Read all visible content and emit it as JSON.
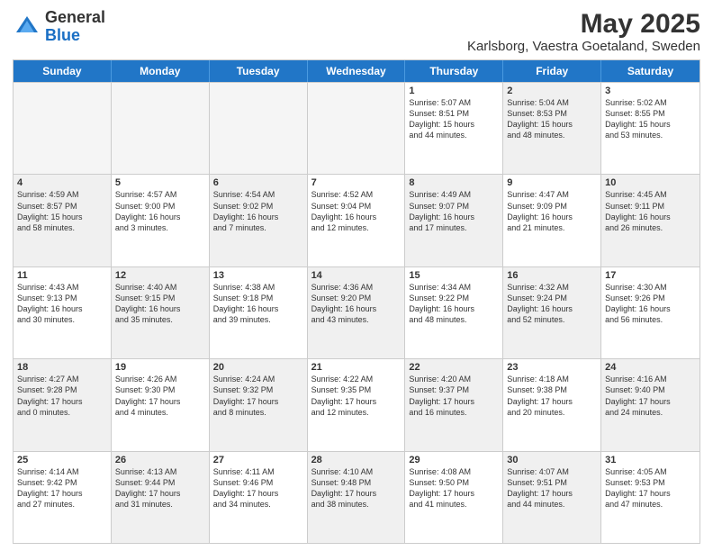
{
  "logo": {
    "general": "General",
    "blue": "Blue"
  },
  "title": "May 2025",
  "subtitle": "Karlsborg, Vaestra Goetaland, Sweden",
  "headers": [
    "Sunday",
    "Monday",
    "Tuesday",
    "Wednesday",
    "Thursday",
    "Friday",
    "Saturday"
  ],
  "rows": [
    [
      {
        "day": "",
        "info": "",
        "empty": true
      },
      {
        "day": "",
        "info": "",
        "empty": true
      },
      {
        "day": "",
        "info": "",
        "empty": true
      },
      {
        "day": "",
        "info": "",
        "empty": true
      },
      {
        "day": "1",
        "info": "Sunrise: 5:07 AM\nSunset: 8:51 PM\nDaylight: 15 hours\nand 44 minutes."
      },
      {
        "day": "2",
        "info": "Sunrise: 5:04 AM\nSunset: 8:53 PM\nDaylight: 15 hours\nand 48 minutes.",
        "shaded": true
      },
      {
        "day": "3",
        "info": "Sunrise: 5:02 AM\nSunset: 8:55 PM\nDaylight: 15 hours\nand 53 minutes."
      }
    ],
    [
      {
        "day": "4",
        "info": "Sunrise: 4:59 AM\nSunset: 8:57 PM\nDaylight: 15 hours\nand 58 minutes.",
        "shaded": true
      },
      {
        "day": "5",
        "info": "Sunrise: 4:57 AM\nSunset: 9:00 PM\nDaylight: 16 hours\nand 3 minutes."
      },
      {
        "day": "6",
        "info": "Sunrise: 4:54 AM\nSunset: 9:02 PM\nDaylight: 16 hours\nand 7 minutes.",
        "shaded": true
      },
      {
        "day": "7",
        "info": "Sunrise: 4:52 AM\nSunset: 9:04 PM\nDaylight: 16 hours\nand 12 minutes."
      },
      {
        "day": "8",
        "info": "Sunrise: 4:49 AM\nSunset: 9:07 PM\nDaylight: 16 hours\nand 17 minutes.",
        "shaded": true
      },
      {
        "day": "9",
        "info": "Sunrise: 4:47 AM\nSunset: 9:09 PM\nDaylight: 16 hours\nand 21 minutes."
      },
      {
        "day": "10",
        "info": "Sunrise: 4:45 AM\nSunset: 9:11 PM\nDaylight: 16 hours\nand 26 minutes.",
        "shaded": true
      }
    ],
    [
      {
        "day": "11",
        "info": "Sunrise: 4:43 AM\nSunset: 9:13 PM\nDaylight: 16 hours\nand 30 minutes."
      },
      {
        "day": "12",
        "info": "Sunrise: 4:40 AM\nSunset: 9:15 PM\nDaylight: 16 hours\nand 35 minutes.",
        "shaded": true
      },
      {
        "day": "13",
        "info": "Sunrise: 4:38 AM\nSunset: 9:18 PM\nDaylight: 16 hours\nand 39 minutes."
      },
      {
        "day": "14",
        "info": "Sunrise: 4:36 AM\nSunset: 9:20 PM\nDaylight: 16 hours\nand 43 minutes.",
        "shaded": true
      },
      {
        "day": "15",
        "info": "Sunrise: 4:34 AM\nSunset: 9:22 PM\nDaylight: 16 hours\nand 48 minutes."
      },
      {
        "day": "16",
        "info": "Sunrise: 4:32 AM\nSunset: 9:24 PM\nDaylight: 16 hours\nand 52 minutes.",
        "shaded": true
      },
      {
        "day": "17",
        "info": "Sunrise: 4:30 AM\nSunset: 9:26 PM\nDaylight: 16 hours\nand 56 minutes."
      }
    ],
    [
      {
        "day": "18",
        "info": "Sunrise: 4:27 AM\nSunset: 9:28 PM\nDaylight: 17 hours\nand 0 minutes.",
        "shaded": true
      },
      {
        "day": "19",
        "info": "Sunrise: 4:26 AM\nSunset: 9:30 PM\nDaylight: 17 hours\nand 4 minutes."
      },
      {
        "day": "20",
        "info": "Sunrise: 4:24 AM\nSunset: 9:32 PM\nDaylight: 17 hours\nand 8 minutes.",
        "shaded": true
      },
      {
        "day": "21",
        "info": "Sunrise: 4:22 AM\nSunset: 9:35 PM\nDaylight: 17 hours\nand 12 minutes."
      },
      {
        "day": "22",
        "info": "Sunrise: 4:20 AM\nSunset: 9:37 PM\nDaylight: 17 hours\nand 16 minutes.",
        "shaded": true
      },
      {
        "day": "23",
        "info": "Sunrise: 4:18 AM\nSunset: 9:38 PM\nDaylight: 17 hours\nand 20 minutes."
      },
      {
        "day": "24",
        "info": "Sunrise: 4:16 AM\nSunset: 9:40 PM\nDaylight: 17 hours\nand 24 minutes.",
        "shaded": true
      }
    ],
    [
      {
        "day": "25",
        "info": "Sunrise: 4:14 AM\nSunset: 9:42 PM\nDaylight: 17 hours\nand 27 minutes."
      },
      {
        "day": "26",
        "info": "Sunrise: 4:13 AM\nSunset: 9:44 PM\nDaylight: 17 hours\nand 31 minutes.",
        "shaded": true
      },
      {
        "day": "27",
        "info": "Sunrise: 4:11 AM\nSunset: 9:46 PM\nDaylight: 17 hours\nand 34 minutes."
      },
      {
        "day": "28",
        "info": "Sunrise: 4:10 AM\nSunset: 9:48 PM\nDaylight: 17 hours\nand 38 minutes.",
        "shaded": true
      },
      {
        "day": "29",
        "info": "Sunrise: 4:08 AM\nSunset: 9:50 PM\nDaylight: 17 hours\nand 41 minutes."
      },
      {
        "day": "30",
        "info": "Sunrise: 4:07 AM\nSunset: 9:51 PM\nDaylight: 17 hours\nand 44 minutes.",
        "shaded": true
      },
      {
        "day": "31",
        "info": "Sunrise: 4:05 AM\nSunset: 9:53 PM\nDaylight: 17 hours\nand 47 minutes."
      }
    ]
  ]
}
